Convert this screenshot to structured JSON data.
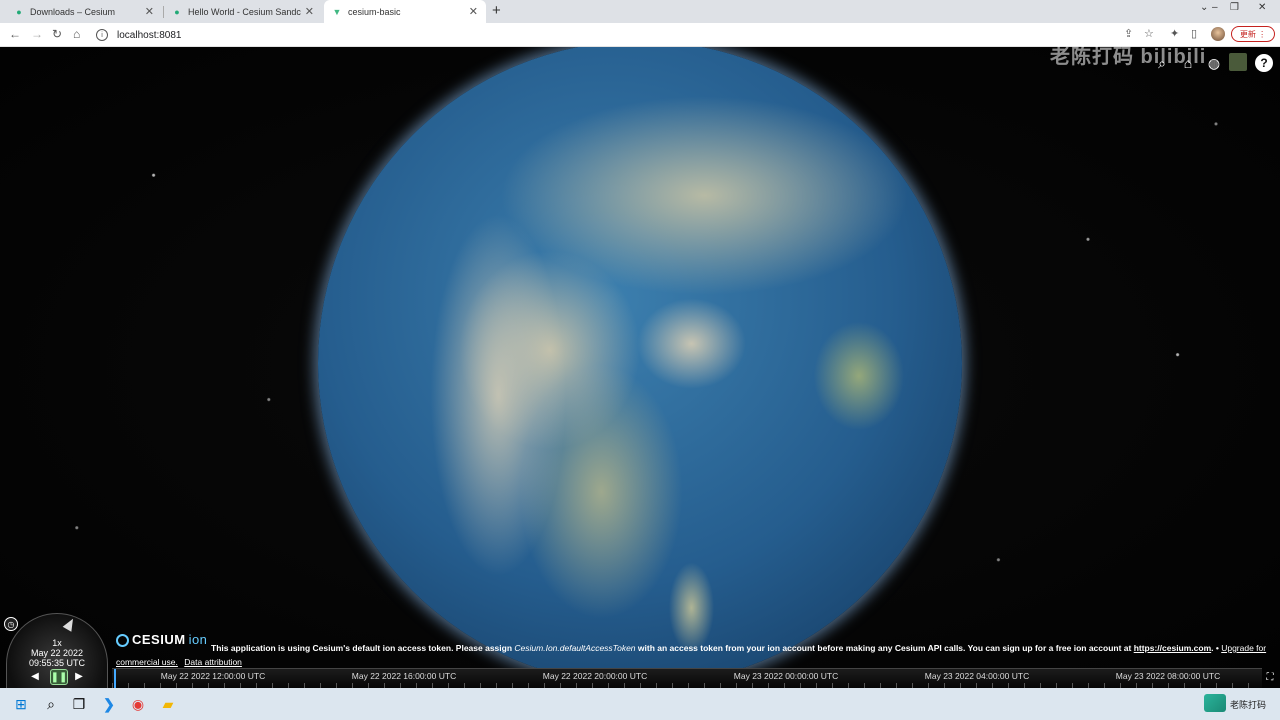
{
  "browser": {
    "tabs": [
      {
        "title": "Downloads – Cesium",
        "active": false
      },
      {
        "title": "Hello World - Cesium Sandcastle",
        "active": false
      },
      {
        "title": "cesium-basic",
        "active": true
      }
    ],
    "new_tab": "+",
    "url": "localhost:8081",
    "update_label": "更新",
    "colors": {
      "tabstrip": "#dee1e6",
      "accent_update": "#c5221f"
    }
  },
  "watermark": "老陈打码 bilibili",
  "cesium": {
    "toolbar_icons": [
      "search-icon",
      "home-icon",
      "scene-mode-globe-icon",
      "base-layer-picker-icon",
      "help-icon"
    ],
    "help_label": "?",
    "animation": {
      "speed": "1x",
      "date": "May 22 2022",
      "time": "09:55:35 UTC"
    },
    "credits": {
      "logo": "CESIUM",
      "logo_suffix": "ion",
      "msg_pre": "This application is using Cesium's default ion access token. Please assign ",
      "msg_code": "Cesium.Ion.defaultAccessToken",
      "msg_mid": " with an access token from your ion account before making any Cesium API calls. You can sign up for a free ion account at ",
      "msg_link": "https://cesium.com",
      "msg_post": ". • ",
      "upgrade_link": "Upgrade for",
      "commercial": "commercial use.",
      "attribution": "Data attribution"
    },
    "timeline_labels": [
      "May 22 2022 12:00:00 UTC",
      "May 22 2022 16:00:00 UTC",
      "May 22 2022 20:00:00 UTC",
      "May 23 2022 00:00:00 UTC",
      "May 23 2022 04:00:00 UTC",
      "May 23 2022 08:00:00 UTC"
    ]
  },
  "taskbar": {
    "items": [
      "windows-start-icon",
      "search-icon",
      "task-view-icon",
      "vscode-icon",
      "chrome-icon",
      "file-explorer-icon"
    ],
    "tray_text": "老陈打码"
  }
}
